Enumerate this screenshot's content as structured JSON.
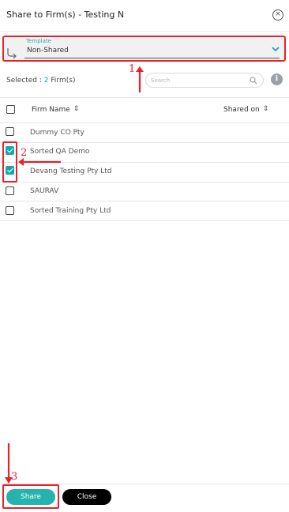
{
  "header": {
    "title": "Share to Firm(s) - Testing N",
    "close_icon": "close-circle-icon"
  },
  "template": {
    "label": "Template",
    "value": "Non-Shared"
  },
  "selection": {
    "prefix": "Selected :",
    "count": "2",
    "suffix": "Firm(s)"
  },
  "search": {
    "placeholder": "Search"
  },
  "table": {
    "columns": [
      "Firm Name",
      "Shared on"
    ],
    "rows": [
      {
        "name": "Dummy CO Pty",
        "checked": false
      },
      {
        "name": "Sorted QA Demo",
        "checked": true
      },
      {
        "name": "Devang Testing Pty Ltd",
        "checked": true
      },
      {
        "name": "SAURAV",
        "checked": false
      },
      {
        "name": "Sorted Training Pty Ltd",
        "checked": false
      }
    ]
  },
  "annotations": [
    "1",
    "2",
    "3"
  ],
  "footer": {
    "share_label": "Share",
    "close_label": "Close"
  },
  "colors": {
    "accent": "#26b3ad",
    "annotation": "#e8202a",
    "close_button": "#000000"
  }
}
